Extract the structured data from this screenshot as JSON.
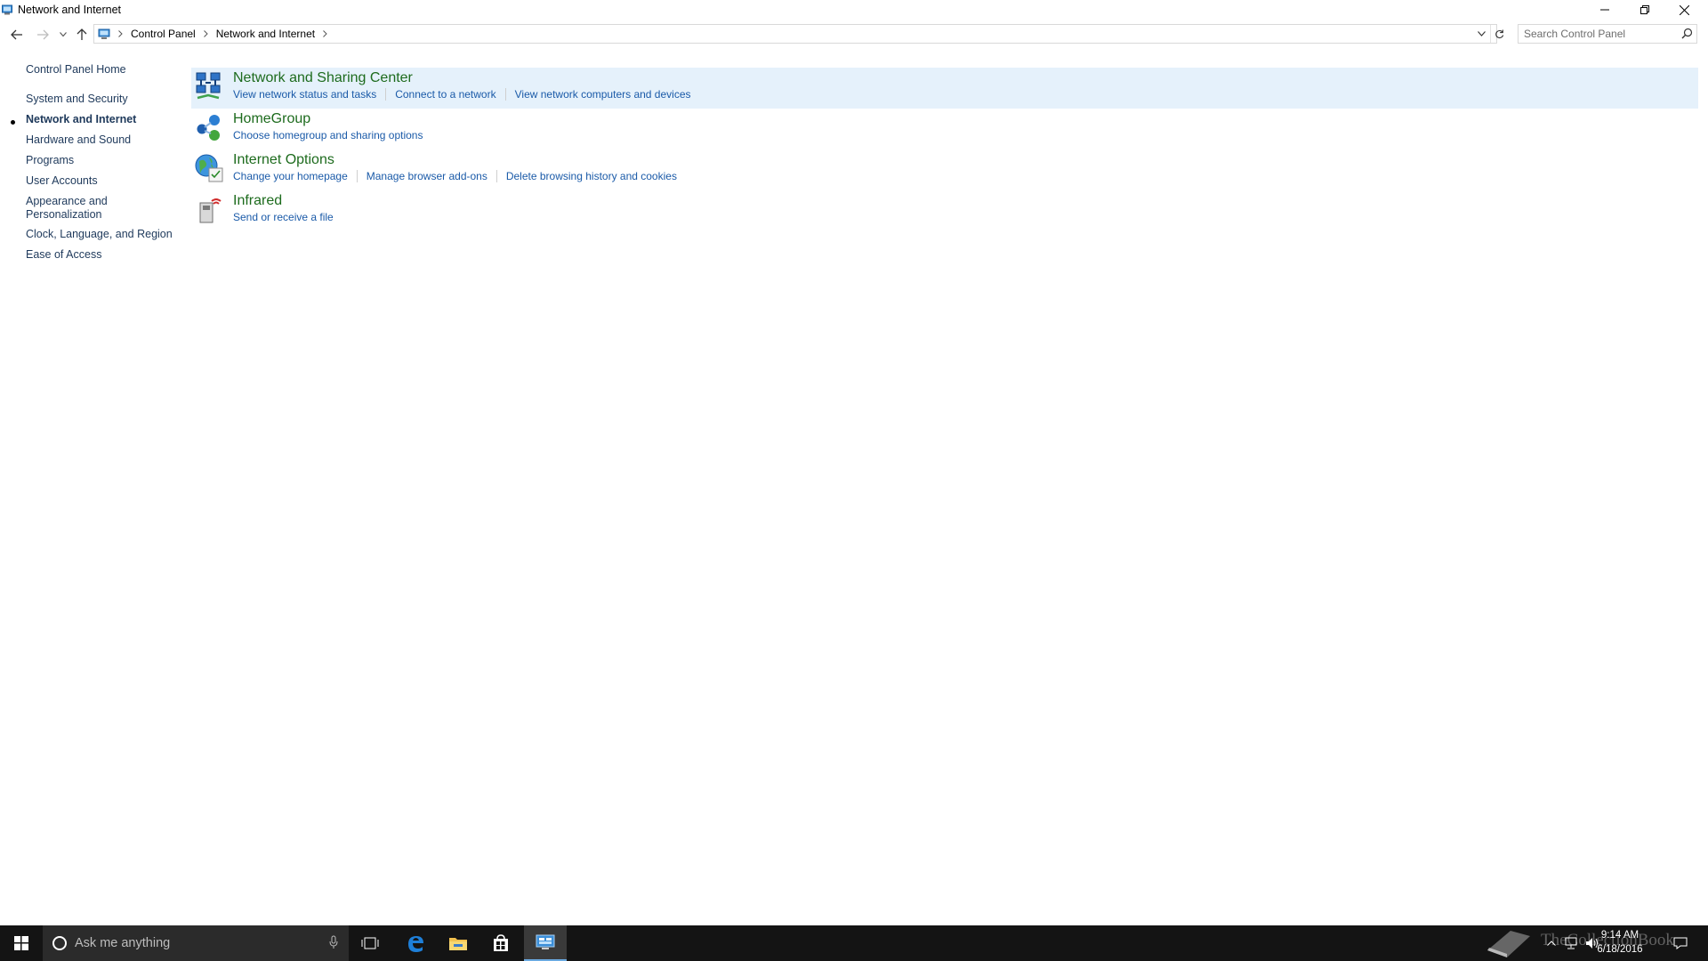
{
  "window": {
    "title": "Network and Internet"
  },
  "address": {
    "crumbs": [
      "Control Panel",
      "Network and Internet"
    ]
  },
  "search": {
    "placeholder": "Search Control Panel"
  },
  "sidebar": {
    "home": "Control Panel Home",
    "items": [
      {
        "label": "System and Security"
      },
      {
        "label": "Network and Internet",
        "active": true
      },
      {
        "label": "Hardware and Sound"
      },
      {
        "label": "Programs"
      },
      {
        "label": "User Accounts"
      },
      {
        "label": "Appearance and Personalization"
      },
      {
        "label": "Clock, Language, and Region"
      },
      {
        "label": "Ease of Access"
      }
    ]
  },
  "categories": [
    {
      "title": "Network and Sharing Center",
      "icon": "network-sharing-icon",
      "links": [
        "View network status and tasks",
        "Connect to a network",
        "View network computers and devices"
      ]
    },
    {
      "title": "HomeGroup",
      "icon": "homegroup-icon",
      "links": [
        "Choose homegroup and sharing options"
      ]
    },
    {
      "title": "Internet Options",
      "icon": "internet-options-icon",
      "links": [
        "Change your homepage",
        "Manage browser add-ons",
        "Delete browsing history and cookies"
      ]
    },
    {
      "title": "Infrared",
      "icon": "infrared-icon",
      "links": [
        "Send or receive a file"
      ]
    }
  ],
  "taskbar": {
    "search_placeholder": "Ask me anything",
    "time": "9:14 AM",
    "date": "6/18/2016",
    "watermark": "TheCollectionBook"
  },
  "colors": {
    "heading_green": "#1d6b1d",
    "link_blue": "#1a5aa8",
    "highlight": "#e5f1fb",
    "taskbar": "#141414"
  }
}
